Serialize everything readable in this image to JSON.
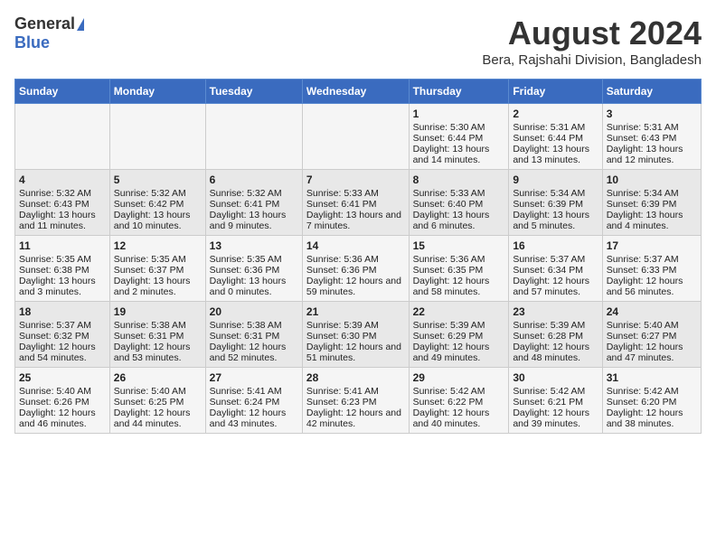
{
  "header": {
    "logo_general": "General",
    "logo_blue": "Blue",
    "title": "August 2024",
    "subtitle": "Bera, Rajshahi Division, Bangladesh"
  },
  "days_of_week": [
    "Sunday",
    "Monday",
    "Tuesday",
    "Wednesday",
    "Thursday",
    "Friday",
    "Saturday"
  ],
  "weeks": [
    [
      {
        "day": "",
        "content": ""
      },
      {
        "day": "",
        "content": ""
      },
      {
        "day": "",
        "content": ""
      },
      {
        "day": "",
        "content": ""
      },
      {
        "day": "1",
        "content": "Sunrise: 5:30 AM\nSunset: 6:44 PM\nDaylight: 13 hours and 14 minutes."
      },
      {
        "day": "2",
        "content": "Sunrise: 5:31 AM\nSunset: 6:44 PM\nDaylight: 13 hours and 13 minutes."
      },
      {
        "day": "3",
        "content": "Sunrise: 5:31 AM\nSunset: 6:43 PM\nDaylight: 13 hours and 12 minutes."
      }
    ],
    [
      {
        "day": "4",
        "content": "Sunrise: 5:32 AM\nSunset: 6:43 PM\nDaylight: 13 hours and 11 minutes."
      },
      {
        "day": "5",
        "content": "Sunrise: 5:32 AM\nSunset: 6:42 PM\nDaylight: 13 hours and 10 minutes."
      },
      {
        "day": "6",
        "content": "Sunrise: 5:32 AM\nSunset: 6:41 PM\nDaylight: 13 hours and 9 minutes."
      },
      {
        "day": "7",
        "content": "Sunrise: 5:33 AM\nSunset: 6:41 PM\nDaylight: 13 hours and 7 minutes."
      },
      {
        "day": "8",
        "content": "Sunrise: 5:33 AM\nSunset: 6:40 PM\nDaylight: 13 hours and 6 minutes."
      },
      {
        "day": "9",
        "content": "Sunrise: 5:34 AM\nSunset: 6:39 PM\nDaylight: 13 hours and 5 minutes."
      },
      {
        "day": "10",
        "content": "Sunrise: 5:34 AM\nSunset: 6:39 PM\nDaylight: 13 hours and 4 minutes."
      }
    ],
    [
      {
        "day": "11",
        "content": "Sunrise: 5:35 AM\nSunset: 6:38 PM\nDaylight: 13 hours and 3 minutes."
      },
      {
        "day": "12",
        "content": "Sunrise: 5:35 AM\nSunset: 6:37 PM\nDaylight: 13 hours and 2 minutes."
      },
      {
        "day": "13",
        "content": "Sunrise: 5:35 AM\nSunset: 6:36 PM\nDaylight: 13 hours and 0 minutes."
      },
      {
        "day": "14",
        "content": "Sunrise: 5:36 AM\nSunset: 6:36 PM\nDaylight: 12 hours and 59 minutes."
      },
      {
        "day": "15",
        "content": "Sunrise: 5:36 AM\nSunset: 6:35 PM\nDaylight: 12 hours and 58 minutes."
      },
      {
        "day": "16",
        "content": "Sunrise: 5:37 AM\nSunset: 6:34 PM\nDaylight: 12 hours and 57 minutes."
      },
      {
        "day": "17",
        "content": "Sunrise: 5:37 AM\nSunset: 6:33 PM\nDaylight: 12 hours and 56 minutes."
      }
    ],
    [
      {
        "day": "18",
        "content": "Sunrise: 5:37 AM\nSunset: 6:32 PM\nDaylight: 12 hours and 54 minutes."
      },
      {
        "day": "19",
        "content": "Sunrise: 5:38 AM\nSunset: 6:31 PM\nDaylight: 12 hours and 53 minutes."
      },
      {
        "day": "20",
        "content": "Sunrise: 5:38 AM\nSunset: 6:31 PM\nDaylight: 12 hours and 52 minutes."
      },
      {
        "day": "21",
        "content": "Sunrise: 5:39 AM\nSunset: 6:30 PM\nDaylight: 12 hours and 51 minutes."
      },
      {
        "day": "22",
        "content": "Sunrise: 5:39 AM\nSunset: 6:29 PM\nDaylight: 12 hours and 49 minutes."
      },
      {
        "day": "23",
        "content": "Sunrise: 5:39 AM\nSunset: 6:28 PM\nDaylight: 12 hours and 48 minutes."
      },
      {
        "day": "24",
        "content": "Sunrise: 5:40 AM\nSunset: 6:27 PM\nDaylight: 12 hours and 47 minutes."
      }
    ],
    [
      {
        "day": "25",
        "content": "Sunrise: 5:40 AM\nSunset: 6:26 PM\nDaylight: 12 hours and 46 minutes."
      },
      {
        "day": "26",
        "content": "Sunrise: 5:40 AM\nSunset: 6:25 PM\nDaylight: 12 hours and 44 minutes."
      },
      {
        "day": "27",
        "content": "Sunrise: 5:41 AM\nSunset: 6:24 PM\nDaylight: 12 hours and 43 minutes."
      },
      {
        "day": "28",
        "content": "Sunrise: 5:41 AM\nSunset: 6:23 PM\nDaylight: 12 hours and 42 minutes."
      },
      {
        "day": "29",
        "content": "Sunrise: 5:42 AM\nSunset: 6:22 PM\nDaylight: 12 hours and 40 minutes."
      },
      {
        "day": "30",
        "content": "Sunrise: 5:42 AM\nSunset: 6:21 PM\nDaylight: 12 hours and 39 minutes."
      },
      {
        "day": "31",
        "content": "Sunrise: 5:42 AM\nSunset: 6:20 PM\nDaylight: 12 hours and 38 minutes."
      }
    ]
  ]
}
